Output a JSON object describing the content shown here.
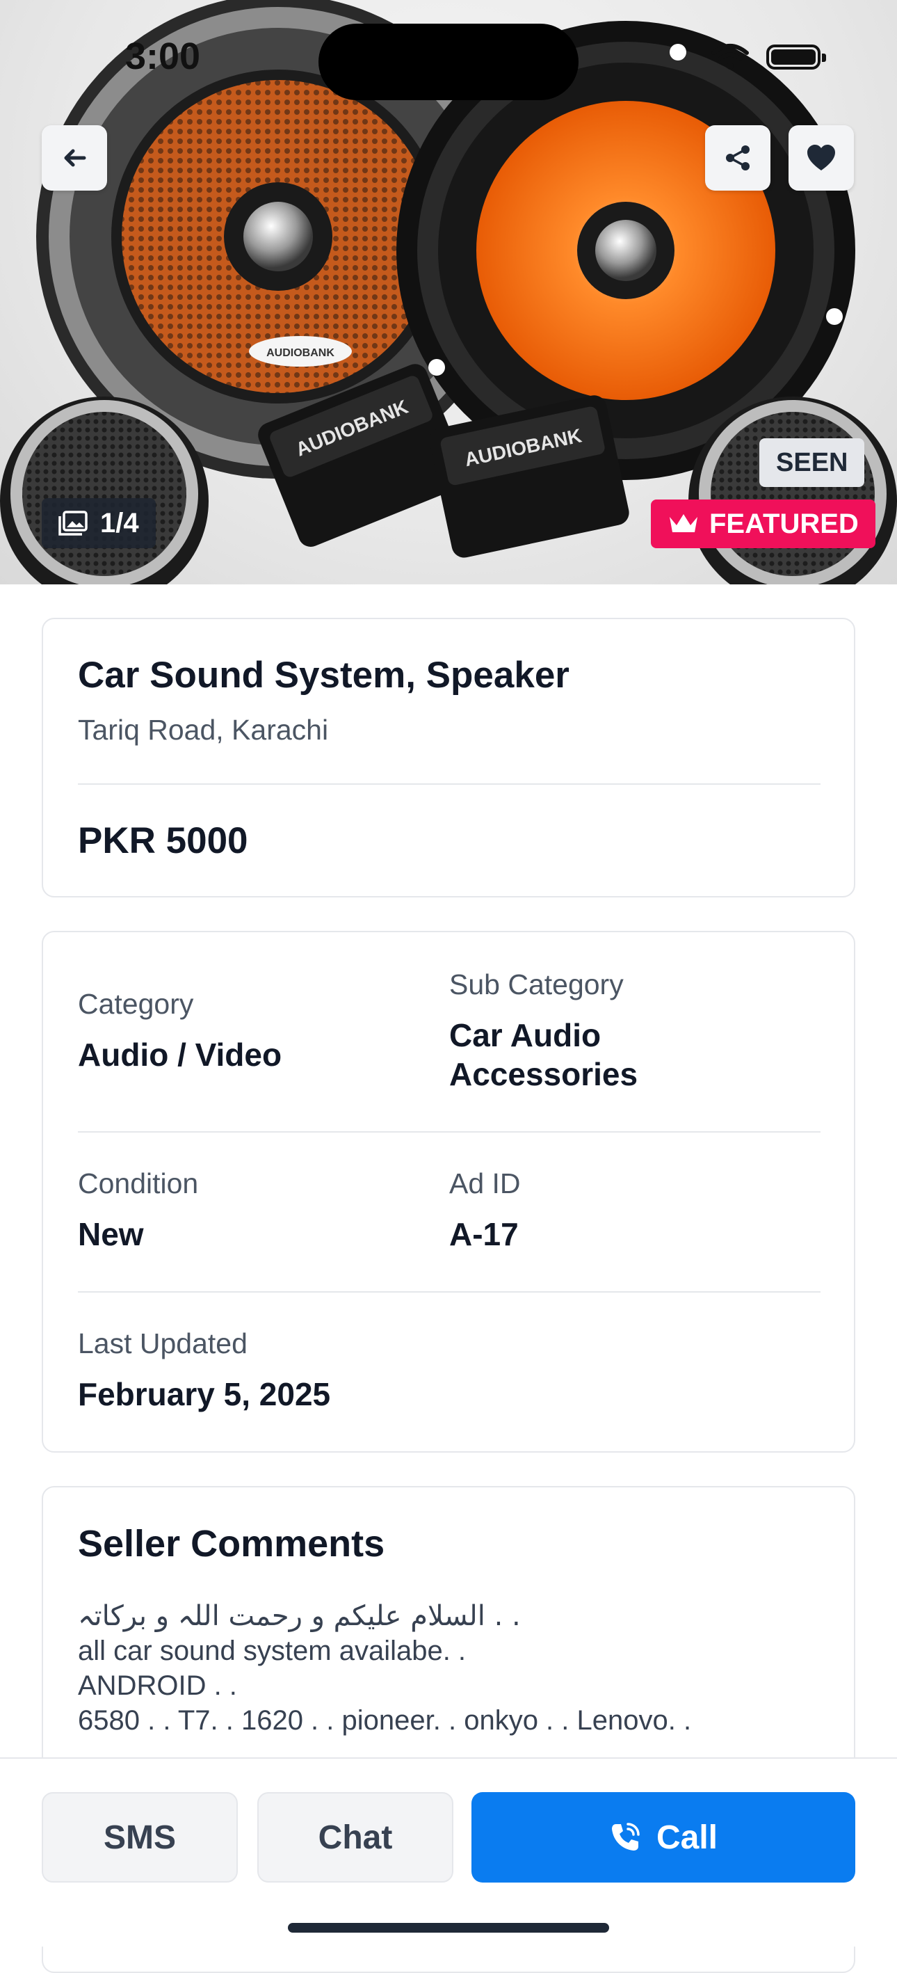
{
  "status_bar": {
    "time": "3:00"
  },
  "hero": {
    "photo_counter": "1/4",
    "seen_label": "SEEN",
    "featured_label": "FEATURED",
    "brand_text": "AUDIOBANK",
    "featured_color": "#f0105a"
  },
  "listing": {
    "title": "Car Sound System, Speaker",
    "location": "Tariq Road, Karachi",
    "price": "PKR 5000"
  },
  "details": {
    "category_label": "Category",
    "category_value": "Audio / Video",
    "subcategory_label": "Sub Category",
    "subcategory_value_line1": "Car Audio",
    "subcategory_value_line2": "Accessories",
    "condition_label": "Condition",
    "condition_value": "New",
    "adid_label": "Ad ID",
    "adid_value": "A-17",
    "updated_label": "Last Updated",
    "updated_value": "February 5, 2025"
  },
  "comments": {
    "title": "Seller Comments",
    "lines": [
      "السلام علیکم و رحمت اللہ و برکاتہ . .",
      "all car sound system availabe. .",
      "ANDROID . .",
      "6580 . . T7. . 1620 . . pioneer. . onkyo . . Lenovo. ."
    ]
  },
  "actions": {
    "sms_label": "SMS",
    "chat_label": "Chat",
    "call_label": "Call",
    "call_color": "#0a7cf0"
  },
  "icons": {
    "back": "arrow-left-icon",
    "share": "share-icon",
    "favorite": "heart-icon",
    "gallery": "image-icon",
    "crown": "crown-icon",
    "phone": "phone-icon"
  }
}
